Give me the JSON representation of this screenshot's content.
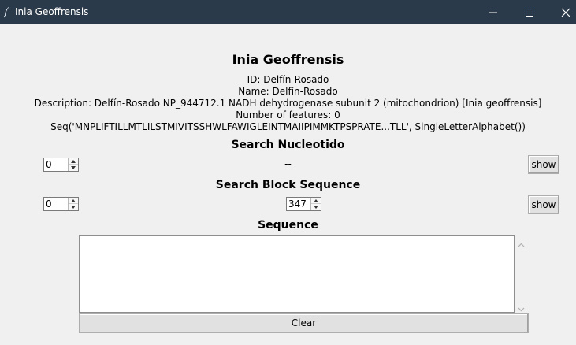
{
  "window": {
    "title": "Inia Geoffrensis",
    "icon": "feather-icon",
    "controls": [
      "minimize-icon",
      "maximize-icon",
      "close-icon"
    ]
  },
  "header": {
    "title": "Inia Geoffrensis",
    "id_line": "ID: Delfín-Rosado",
    "name_line": "Name: Delfín-Rosado",
    "description_line": "Description: Delfín-Rosado NP_944712.1 NADH dehydrogenase subunit 2 (mitochondrion) [Inia geoffrensis]",
    "features_line": "Number of features: 0",
    "seq_line": "Seq('MNPLIFTILLMTLILSTMIVITSSHWLFAWIGLEINTMAIIPIMMKTPSPRATE...TLL', SingleLetterAlphabet())"
  },
  "search_nucleotido": {
    "heading": "Search Nucleotido",
    "spin_value": "0",
    "result": "--",
    "show_label": "show"
  },
  "search_block": {
    "heading": "Search Block Sequence",
    "start_value": "0",
    "end_value": "347",
    "show_label": "show"
  },
  "sequence": {
    "heading": "Sequence",
    "content": "",
    "clear_label": "Clear"
  }
}
